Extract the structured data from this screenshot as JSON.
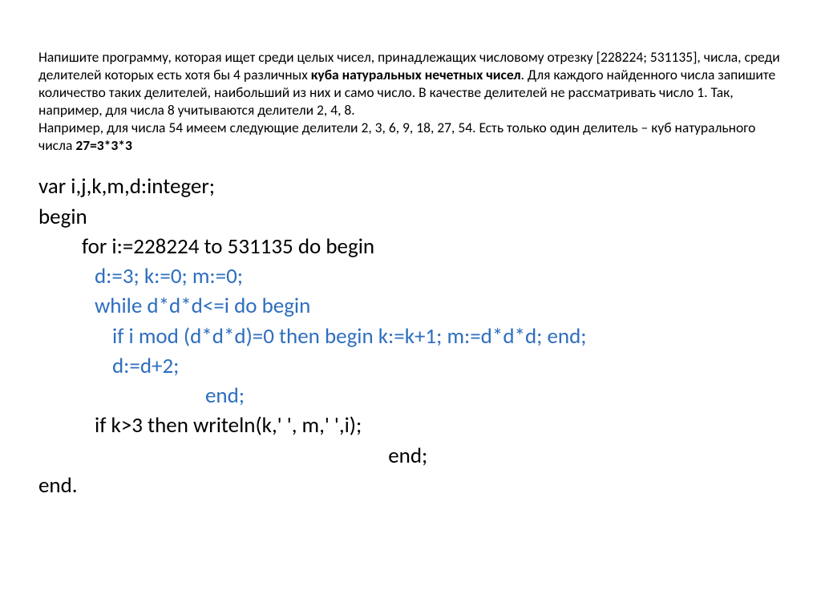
{
  "problem": {
    "p1_a": "Напишите программу, которая ищет среди целых чисел, принадлежащих числовому отрезку [228224; 531135], числа, среди делителей которых есть хотя бы 4 различных ",
    "p1_b": "куба натуральных нечетных чисел",
    "p1_c": ". Для каждого найденного числа запишите количество таких делителей, наибольший из них и само число. В качестве делителей не рассматривать число 1. Так, например, для числа 8 учитываются делители 2, 4, 8.",
    "p2_a": "Например, для числа 54 имеем следующие делители 2, 3, 6, 9, 18, 27, 54.  Есть только один делитель – куб натурального числа  ",
    "p2_b": "27=3*3*3"
  },
  "code": {
    "l1": "var i,j,k,m,d:integer;",
    "l2": "begin",
    "l3": "for i:=228224 to 531135 do begin",
    "l4": "d:=3; k:=0; m:=0;",
    "l5": "while d*d*d<=i do begin",
    "l6": "if i mod (d*d*d)=0 then begin k:=k+1; m:=d*d*d; end;",
    "l7": "d:=d+2;",
    "l8": "                   end;",
    "l9": "if k>3 then writeln(k,' ', m,' ',i);",
    "l10": "                                                            end;",
    "l11": "end."
  }
}
